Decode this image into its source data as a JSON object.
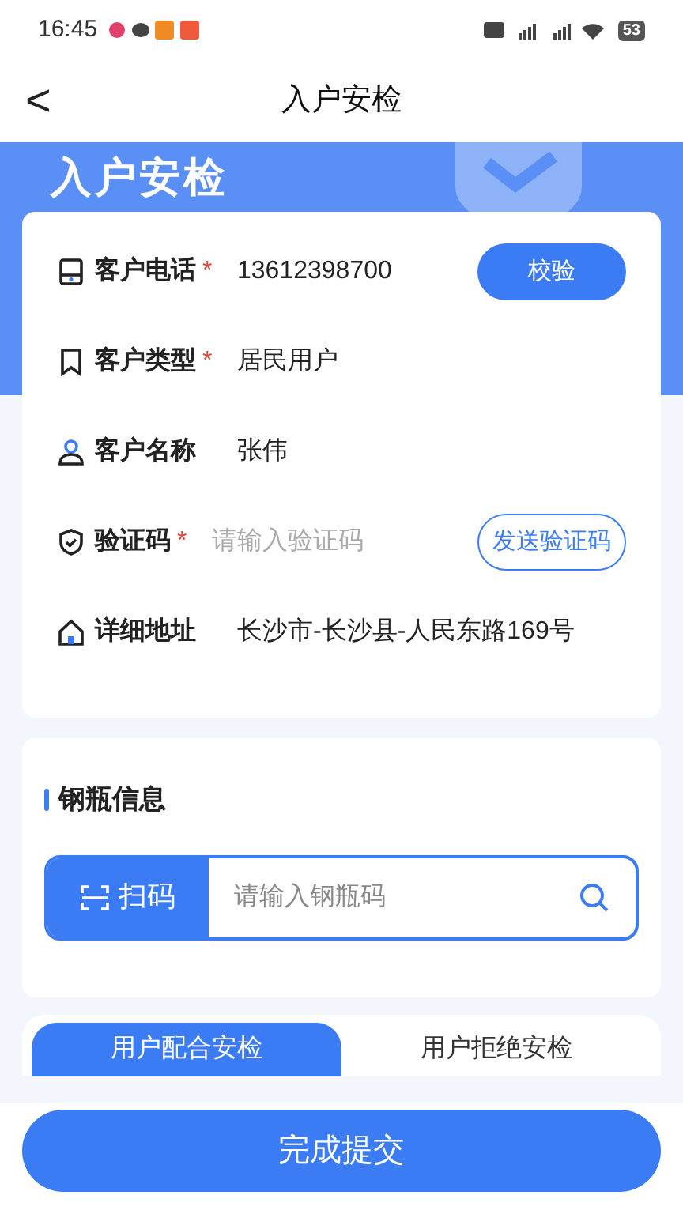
{
  "status_bar": {
    "time": "16:45",
    "battery": "53"
  },
  "header": {
    "back": "<",
    "title": "入户安检"
  },
  "banner": {
    "title": "入户安检"
  },
  "customer_fields": [
    {
      "kind": "phone",
      "label": "客户电话",
      "required_mark": "*",
      "value": "13612398700",
      "button": {
        "label": "校验",
        "filled": true
      }
    },
    {
      "kind": "type",
      "label": "客户类型",
      "required_mark": "*",
      "value": "居民用户"
    },
    {
      "kind": "person",
      "label": "客户名称",
      "value": "张伟"
    },
    {
      "kind": "code",
      "label": "验证码",
      "required_mark": "*",
      "placeholder": "请输入验证码",
      "button": {
        "label": "发送验证码",
        "filled": false
      }
    },
    {
      "kind": "address",
      "label": "详细地址",
      "value": "长沙市-长沙县-人民东路169号"
    }
  ],
  "cylinder_section": {
    "title": "钢瓶信息",
    "scan_button": "扫码",
    "placeholder": "请输入钢瓶码"
  },
  "tabs": [
    {
      "label": "用户配合安检",
      "selected": true
    },
    {
      "label": "用户拒绝安检",
      "selected": false
    }
  ],
  "submit_button": "完成提交"
}
